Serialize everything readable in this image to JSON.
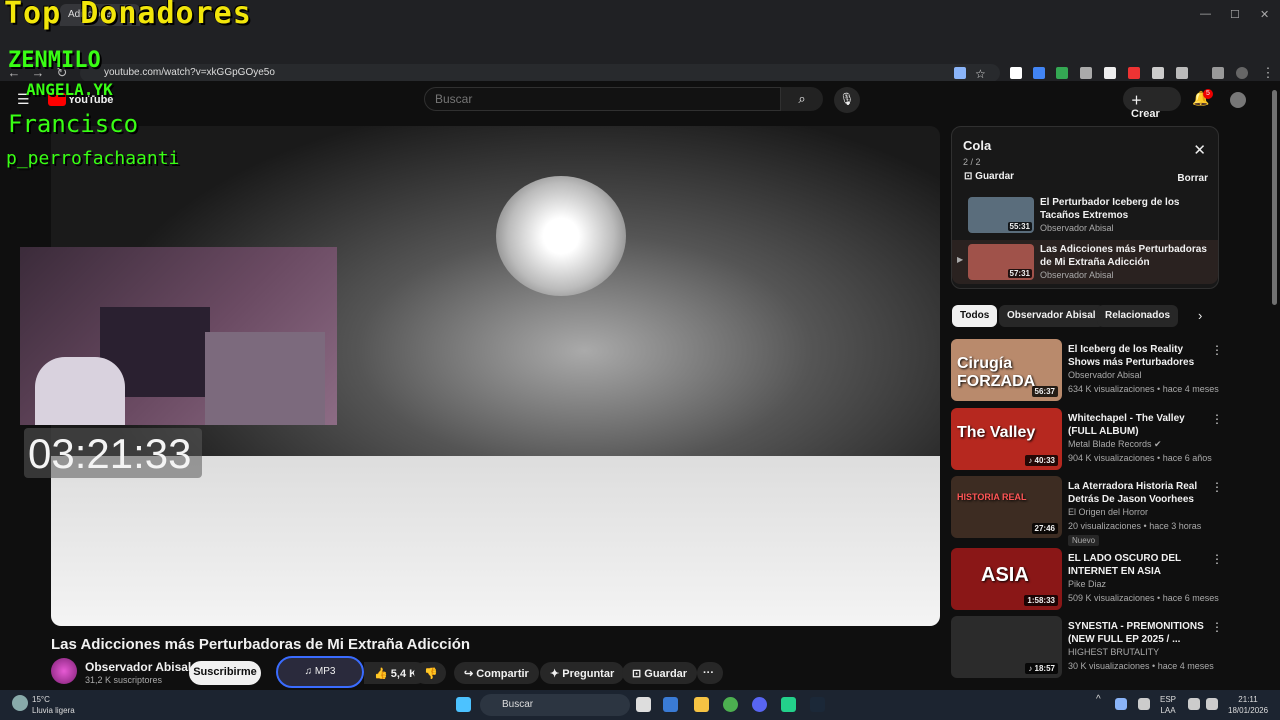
{
  "browser": {
    "tab_title": "Adicciones ...",
    "url": "youtube.com/watch?v=xkGGpGOye5o",
    "window_controls": [
      "—",
      "☐",
      "✕"
    ]
  },
  "overlay": {
    "title": "Top Donadores",
    "donors": [
      "ZENMILO",
      "ANGELA.YK",
      "Francisco",
      "p_perrofachaanti"
    ]
  },
  "youtube": {
    "logo_label": "YouTube",
    "search_placeholder": "Buscar",
    "create_label": "Crear",
    "notification_count": "5"
  },
  "video": {
    "timer_overlay": "03:21:33",
    "title": "Las Adicciones más Perturbadoras de Mi Extraña Adicción",
    "channel": "Observador Abisal",
    "subscribers": "31,2 K suscriptores",
    "subscribe_label": "Suscribirme",
    "mp3_label": "MP3",
    "likes": "5,4 K",
    "share_label": "Compartir",
    "ask_label": "Preguntar",
    "save_label": "Guardar",
    "more_label": "···"
  },
  "queue": {
    "title": "Cola",
    "count": "2 / 2",
    "save_label": "Guardar",
    "clear_label": "Borrar",
    "items": [
      {
        "title": "El Perturbador Iceberg de los Tacaños Extremos",
        "channel": "Observador Abisal",
        "duration": "55:31",
        "color": "#5a6d7c"
      },
      {
        "title": "Las Adicciones más Perturbadoras de Mi Extraña Adicción",
        "channel": "Observador Abisal",
        "duration": "57:31",
        "color": "#a0524a"
      }
    ]
  },
  "chips": [
    "Todos",
    "Observador Abisal",
    "Relacionados"
  ],
  "recommendations": [
    {
      "title": "El Iceberg de los Reality Shows más Perturbadores",
      "channel": "Observador Abisal",
      "meta": "634 K visualizaciones • hace 4 meses",
      "duration": "56:37",
      "thumb_text": "Cirugía FORZADA",
      "color": "#b98a6c",
      "badge": ""
    },
    {
      "title": "Whitechapel - The Valley (FULL ALBUM)",
      "channel": "Metal Blade Records ✔",
      "meta": "904 K visualizaciones • hace 6 años",
      "duration": "♪ 40:33",
      "thumb_text": "The Valley",
      "color": "#b6281f",
      "badge": ""
    },
    {
      "title": "La Aterradora Historia Real Detrás De Jason Voorhees",
      "channel": "El Origen del Horror",
      "meta": "20 visualizaciones • hace 3 horas",
      "duration": "27:46",
      "thumb_text": "HISTORIA REAL",
      "color": "#3d2c22",
      "badge": "Nuevo"
    },
    {
      "title": "EL LADO OSCURO DEL INTERNET EN ASIA",
      "channel": "Pike Diaz",
      "meta": "509 K visualizaciones • hace 6 meses",
      "duration": "1:58:33",
      "thumb_text": "ASIA",
      "color": "#8a1717",
      "badge": ""
    },
    {
      "title": "SYNESTIA - PREMONITIONS (NEW FULL EP 2025 / ...",
      "channel": "HIGHEST BRUTALITY",
      "meta": "30 K visualizaciones • hace 4 meses",
      "duration": "♪ 18:57",
      "thumb_text": "",
      "color": "#2b2b2b",
      "badge": ""
    }
  ],
  "taskbar": {
    "temperature": "15°C",
    "weather": "Lluvia ligera",
    "search_label": "Buscar",
    "language": "ESP",
    "layout": "LAA",
    "time": "21:11",
    "date": "18/01/2026"
  },
  "colors": {
    "accent_blue": "#3a6cff",
    "overlay_yellow": "#f2e60a",
    "overlay_green": "#39ff14",
    "notif_red": "#e00000"
  }
}
